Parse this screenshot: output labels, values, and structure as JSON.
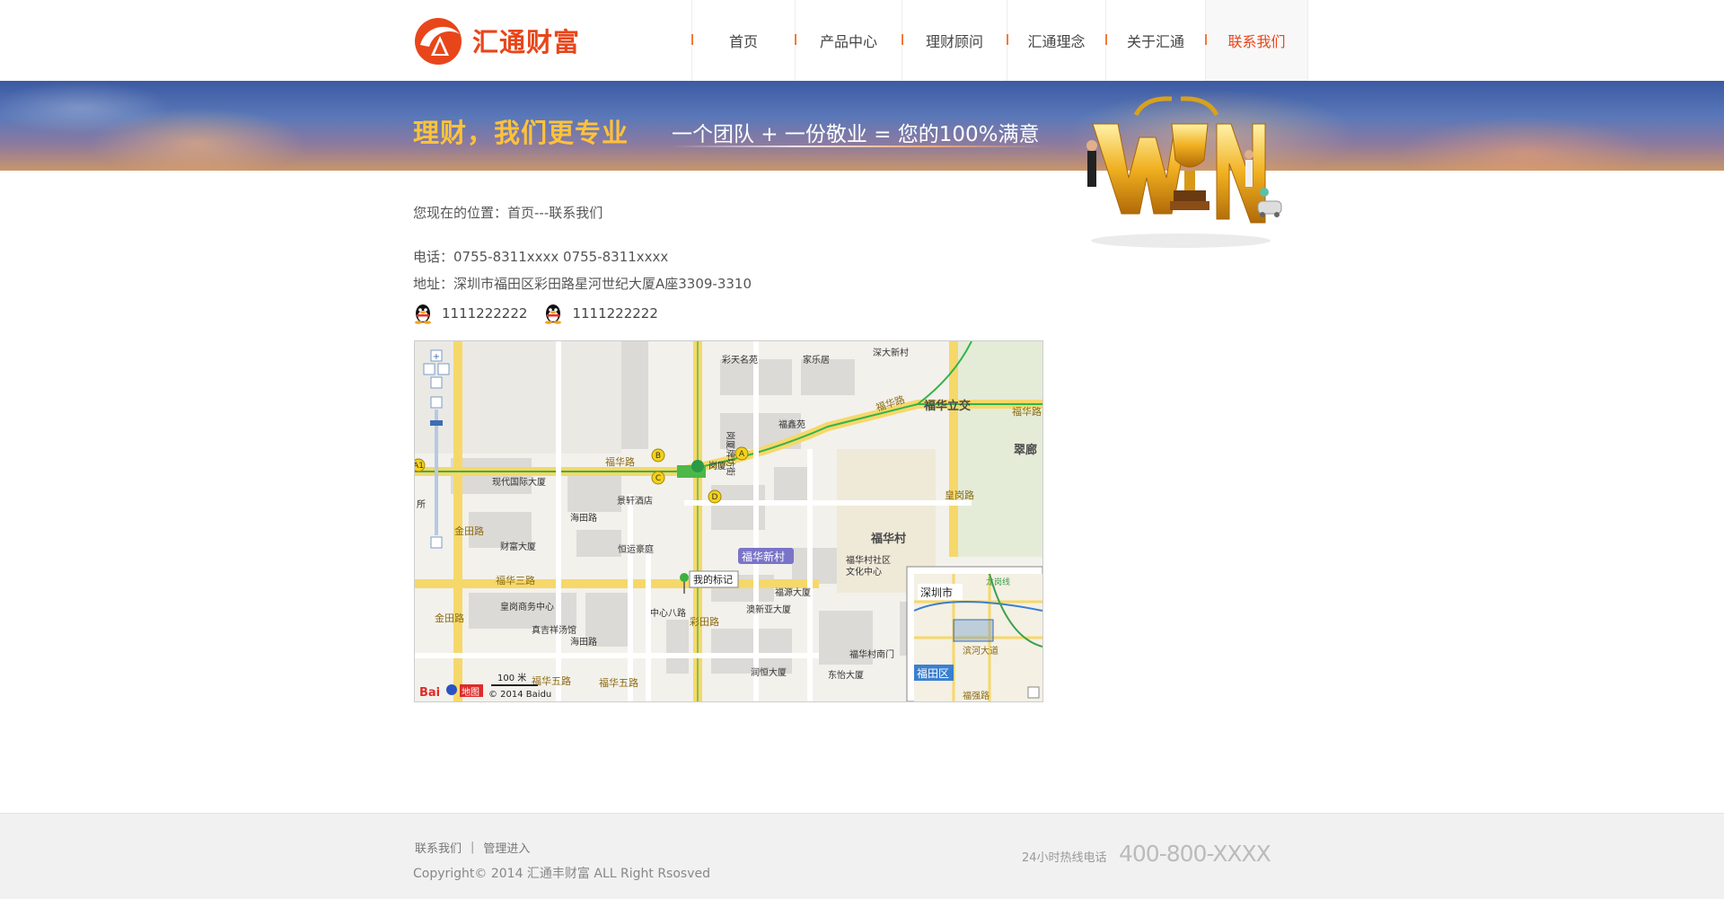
{
  "brand": {
    "name": "汇通财富",
    "accent": "#e8461a"
  },
  "nav": {
    "items": [
      {
        "label": "首页",
        "active": false
      },
      {
        "label": "产品中心",
        "active": false
      },
      {
        "label": "理财顾问",
        "active": false
      },
      {
        "label": "汇通理念",
        "active": false
      },
      {
        "label": "关于汇通",
        "active": false
      },
      {
        "label": "联系我们",
        "active": true
      }
    ]
  },
  "banner": {
    "slogan_main": "理财，我们更专业",
    "slogan_sub": "一个团队 + 一份敬业 = 您的100%满意"
  },
  "breadcrumb": "您现在的位置：首页---联系我们",
  "contact": {
    "phone": "电话：0755-8311xxxx     0755-8311xxxx",
    "address": "地址：深圳市福田区彩田路星河世纪大厦A座3309-3310",
    "qq": [
      "1111222222",
      "1111222222"
    ]
  },
  "map": {
    "labels": {
      "rd_fuhua": "福华路",
      "rd_fuhua2": "福华路",
      "rd_fuhua_east": "福华路",
      "fuhua_overpass": "福华立交",
      "cuilang": "翠廊",
      "fuhua_village": "福华村",
      "fuhua_xincun": "福华新村",
      "my_marker": "我的标记",
      "rd_fuhua3": "福华三路",
      "rd_fuhua5a": "福华五路",
      "rd_fuhua5b": "福华五路",
      "gangxia": "岗厦",
      "xiandai": "现代国际大厦",
      "jingxuan": "景轩酒店",
      "caifu": "财富大厦",
      "hengyun": "恒运豪庭",
      "huanggang_center": "皇岗商务中心",
      "zhenji": "真吉祥汤馆",
      "fuyuan": "福源大厦",
      "aoxinya": "澳新亚大厦",
      "runheng": "润恒大厦",
      "dongyi": "东怡大厦",
      "fuhua_south": "福华村南门",
      "fuhua_community": "福华村社区",
      "culture_center": "文化中心",
      "caixin": "彩天名苑",
      "jialeju": "家乐居",
      "shenda_xincun": "深大新村",
      "fuxin": "福鑫苑",
      "gangxia_street": "岗厦牌坊街",
      "haitian_rd": "海田路",
      "haitian_rd2": "海田路",
      "jintian_rd": "金田路",
      "jintian_rd2": "金田路",
      "caitian_rd": "彩田路",
      "center8": "中心八路",
      "huanggang_rd": "皇岗路",
      "station_a": "A",
      "station_b": "B",
      "station_c": "C",
      "station_d": "D",
      "station_a1": "A1",
      "partial_suo": "所",
      "scale": "100 米",
      "copyright": "© 2014 Baidu",
      "baidu_logo": "Bai",
      "baidu_map": "地图",
      "inset_city": "深圳市",
      "inset_line": "龙岗线",
      "inset_district": "福田区",
      "inset_binhe": "滨河大道",
      "inset_road": "福强路"
    }
  },
  "footer": {
    "link_contact": "联系我们",
    "separator": "|",
    "link_admin": "管理进入",
    "copyright": "Copyright© 2014 汇通丰财富 ALL Right Rsosved",
    "hotline_label": "24小时热线电话",
    "hotline_number": "400-800-XXXX"
  }
}
